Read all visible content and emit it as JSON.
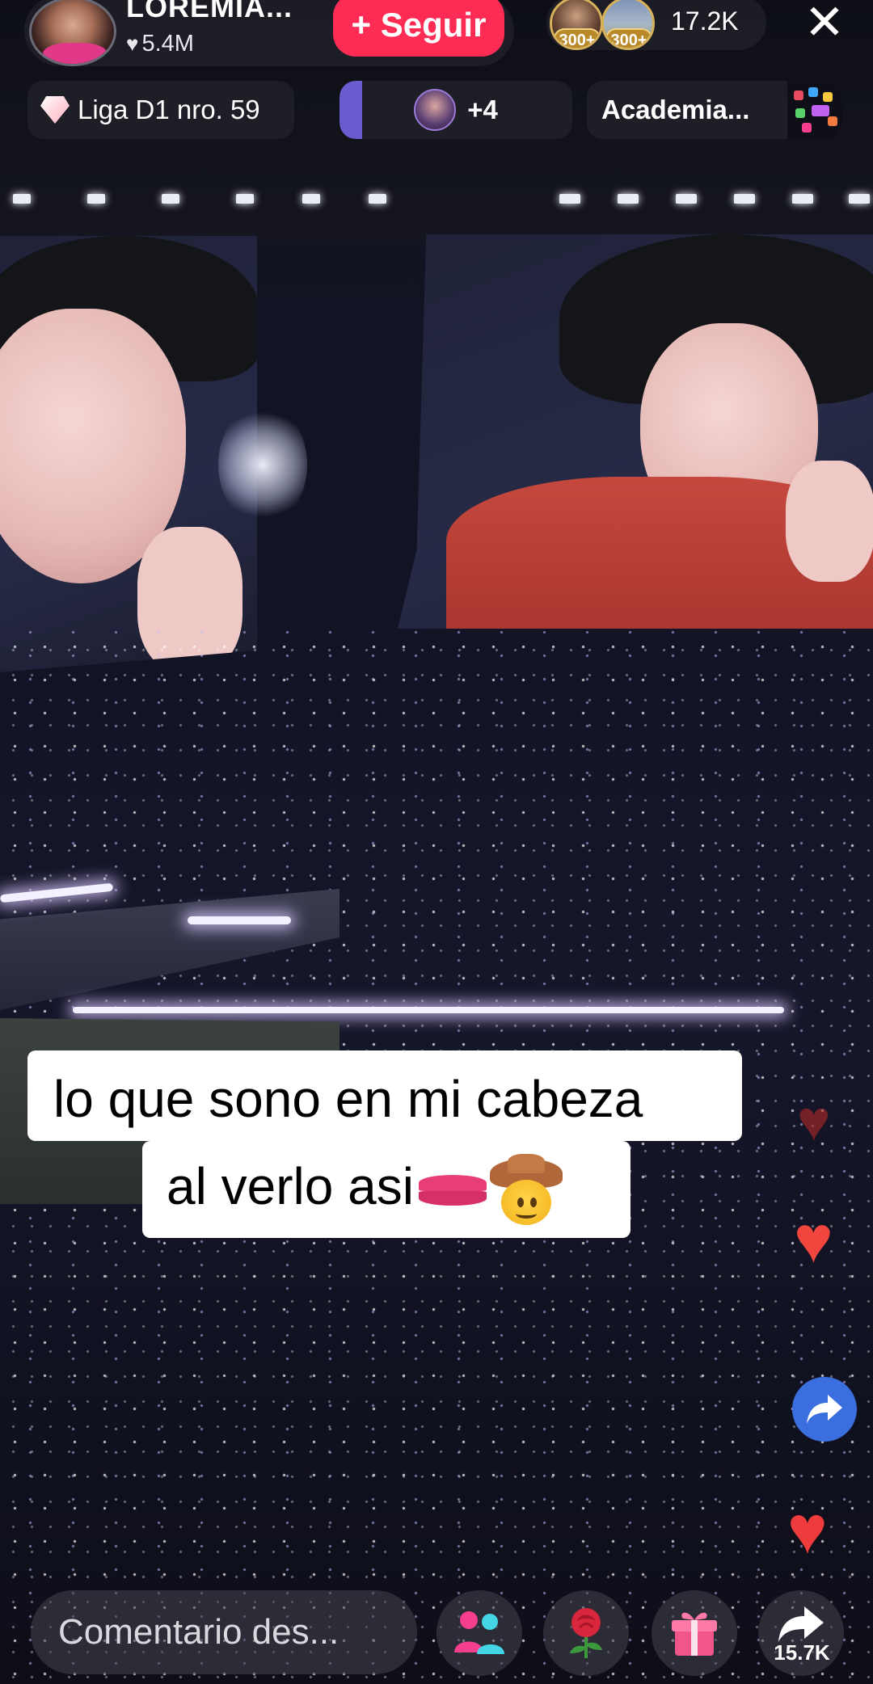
{
  "host": {
    "name": "LOREMIA...",
    "likes": "5.4M",
    "follow_label": "+ Seguir"
  },
  "viewers": {
    "badge_1": "300+",
    "badge_2": "300+",
    "count": "17.2K"
  },
  "header_row": {
    "league_label": "Liga D1 nro. 59",
    "guests_label": "+4",
    "academy_label": "Academia..."
  },
  "caption": {
    "line1": "lo que sono en mi cabeza",
    "line2": "al verlo asi"
  },
  "bottom_bar": {
    "comment_placeholder": "Comentario des...",
    "share_count": "15.7K"
  },
  "colors": {
    "follow_button": "#fe2c55",
    "share_float": "#3b6fe0",
    "heart": "#f0463d",
    "league_gem": "#ffd6dd"
  },
  "icons": [
    "close-icon",
    "heart-icon",
    "diamond-icon",
    "people-icon",
    "rose-icon",
    "gift-icon",
    "share-icon"
  ]
}
